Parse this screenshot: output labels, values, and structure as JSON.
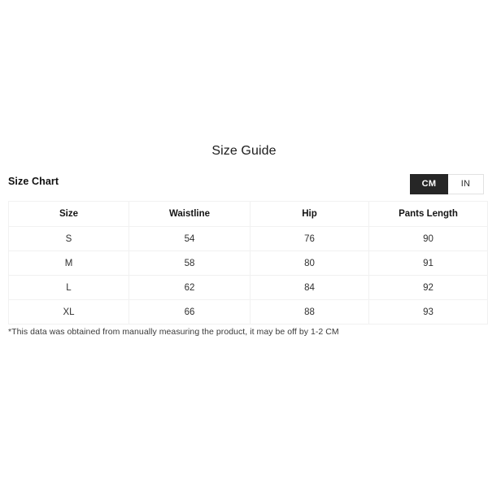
{
  "title": "Size Guide",
  "chart": {
    "label": "Size Chart",
    "units": {
      "selected": "CM",
      "options": [
        {
          "id": "cm",
          "label": "CM",
          "active": true
        },
        {
          "id": "in",
          "label": "IN",
          "active": false
        }
      ]
    },
    "columns": [
      "Size",
      "Waistline",
      "Hip",
      "Pants Length"
    ],
    "rows": [
      {
        "size": "S",
        "waistline": "54",
        "hip": "76",
        "pants_length": "90"
      },
      {
        "size": "M",
        "waistline": "58",
        "hip": "80",
        "pants_length": "91"
      },
      {
        "size": "L",
        "waistline": "62",
        "hip": "84",
        "pants_length": "92"
      },
      {
        "size": "XL",
        "waistline": "66",
        "hip": "88",
        "pants_length": "93"
      }
    ]
  },
  "footnote": "*This data was obtained from manually measuring the product, it may be off by 1-2 CM",
  "colors": {
    "active_toggle_bg": "#262626",
    "active_toggle_text": "#ffffff",
    "table_border": "#f1f1f1",
    "page_bg": "#ffffff",
    "text": "#1a1a1a"
  }
}
